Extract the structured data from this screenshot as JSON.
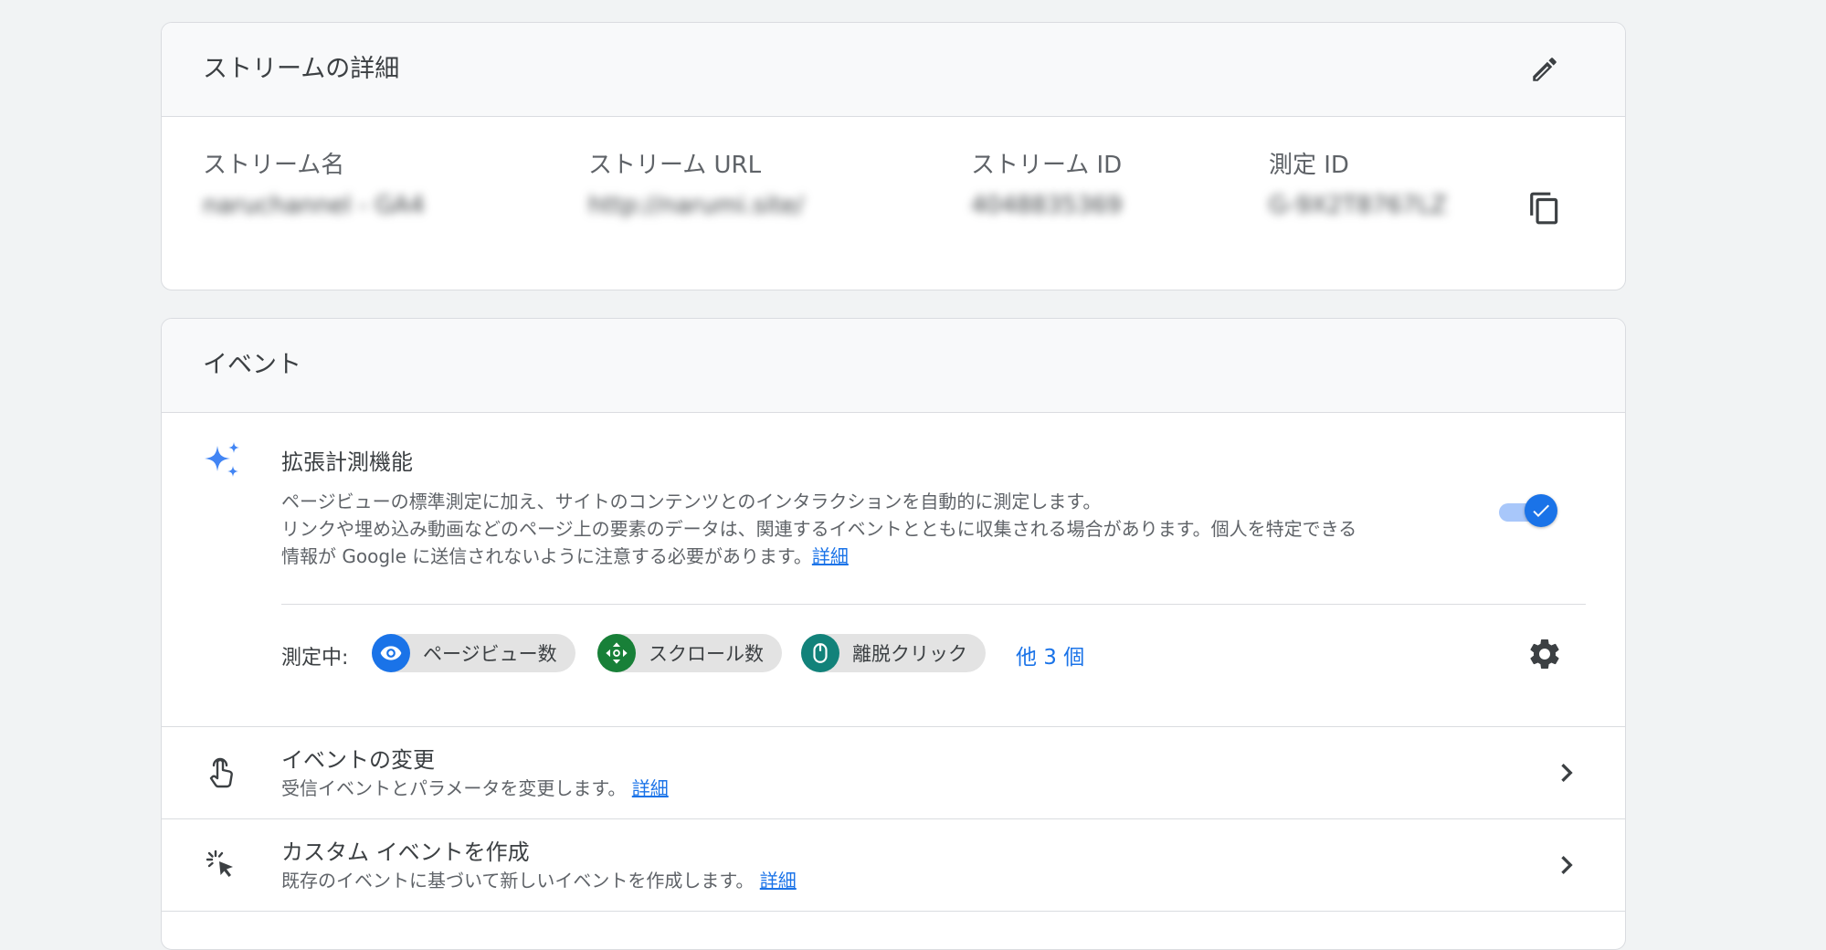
{
  "stream_card": {
    "title": "ストリームの詳細",
    "edit_icon": "pencil-icon",
    "columns": [
      {
        "label": "ストリーム名",
        "value": "naruchannel - GA4"
      },
      {
        "label": "ストリーム URL",
        "value": "http://narumi.site/"
      },
      {
        "label": "ストリーム ID",
        "value": "4048835369"
      },
      {
        "label": "測定 ID",
        "value": "G-9X2T8767LZ"
      }
    ],
    "copy_icon": "copy-icon"
  },
  "events_card": {
    "title": "イベント",
    "enhanced": {
      "icon": "sparkle-icon",
      "title": "拡張計測機能",
      "desc_line1": "ページビューの標準測定に加え、サイトのコンテンツとのインタラクションを自動的に測定します。",
      "desc_line2": "リンクや埋め込み動画などのページ上の要素のデータは、関連するイベントとともに収集される場合があります。個人を特定できる",
      "desc_line3": "情報が Google に送信されないように注意する必要があります。",
      "link": "詳細",
      "toggle_on": true,
      "toggle_color": "#1a73e8"
    },
    "measuring": {
      "label": "測定中:",
      "chips": [
        {
          "label": "ページビュー数",
          "icon": "eye-icon",
          "color": "#1a73e8"
        },
        {
          "label": "スクロール数",
          "icon": "scroll-arrows-icon",
          "color": "#188038"
        },
        {
          "label": "離脱クリック",
          "icon": "mouse-icon",
          "color": "#12827a"
        }
      ],
      "more": "他 3 個",
      "settings_icon": "gear-icon"
    },
    "rows": [
      {
        "title": "イベントの変更",
        "desc": "受信イベントとパラメータを変更します。",
        "link": "詳細",
        "icon": "touch-hand-icon"
      },
      {
        "title": "カスタム イベントを作成",
        "desc": "既存のイベントに基づいて新しいイベントを作成します。",
        "link": "詳細",
        "icon": "cursor-click-icon"
      }
    ]
  }
}
